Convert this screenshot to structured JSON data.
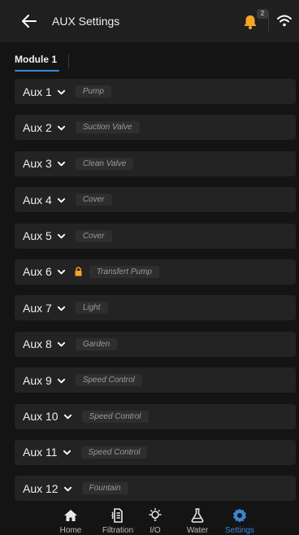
{
  "header": {
    "title": "AUX Settings",
    "notification_count": "2"
  },
  "tabs": [
    {
      "label": "Module 1"
    }
  ],
  "aux_items": [
    {
      "label": "Aux 1",
      "function": "Pump",
      "locked": false
    },
    {
      "label": "Aux 2",
      "function": "Suction Valve",
      "locked": false
    },
    {
      "label": "Aux 3",
      "function": "Clean Valve",
      "locked": false
    },
    {
      "label": "Aux 4",
      "function": "Cover",
      "locked": false
    },
    {
      "label": "Aux 5",
      "function": "Cover",
      "locked": false
    },
    {
      "label": "Aux 6",
      "function": "Transfert Pump",
      "locked": true
    },
    {
      "label": "Aux 7",
      "function": "Light",
      "locked": false
    },
    {
      "label": "Aux 8",
      "function": "Garden",
      "locked": false
    },
    {
      "label": "Aux 9",
      "function": "Speed Control",
      "locked": false
    },
    {
      "label": "Aux 10",
      "function": "Speed Control",
      "locked": false
    },
    {
      "label": "Aux 11",
      "function": "Speed Control",
      "locked": false
    },
    {
      "label": "Aux 12",
      "function": "Fountain",
      "locked": false
    }
  ],
  "bottom_nav": [
    {
      "label": "Home",
      "icon": "home-icon",
      "active": false
    },
    {
      "label": "Filtration",
      "icon": "filtration-icon",
      "active": false
    },
    {
      "label": "I/O",
      "icon": "bulb-icon",
      "active": false
    },
    {
      "label": "Water",
      "icon": "flask-icon",
      "active": false
    },
    {
      "label": "Settings",
      "icon": "gear-icon",
      "active": true
    }
  ],
  "colors": {
    "accent": "#3a86d4",
    "bell": "#f5a623",
    "background": "#141414",
    "row": "#232323"
  }
}
